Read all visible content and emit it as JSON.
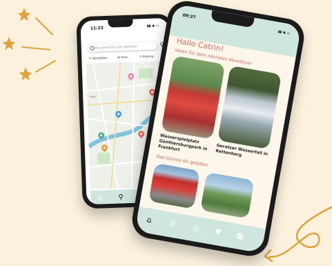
{
  "background_color": "#fbf1dd",
  "accent_color": "#d96b5f",
  "map_phone": {
    "status_time": "11:23",
    "search_placeholder": "Was suchst du? (Ort, Aktivität)",
    "filters": [
      "Spielplätze",
      "Tiere",
      "Bildung"
    ],
    "map_label": "Mapa",
    "tabbar_icons": [
      "home-icon",
      "search-icon",
      "pin-icon",
      "heart-icon"
    ]
  },
  "app_phone": {
    "status_time": "09:37",
    "greeting": "Hallo Catrin!",
    "ideas_heading": "Ideen für dein nächstes Abenteuer",
    "cards": [
      {
        "title": "Wasserspielplatz Günthersburgpark in Frankfurt"
      },
      {
        "title": "Geratser Wasserfall in Rettenberg"
      }
    ],
    "liked_heading": "Das könnte dir gefallen",
    "tabbar_icons": [
      "home-icon",
      "search-icon",
      "pin-icon",
      "heart-icon",
      "calendar-icon"
    ]
  }
}
